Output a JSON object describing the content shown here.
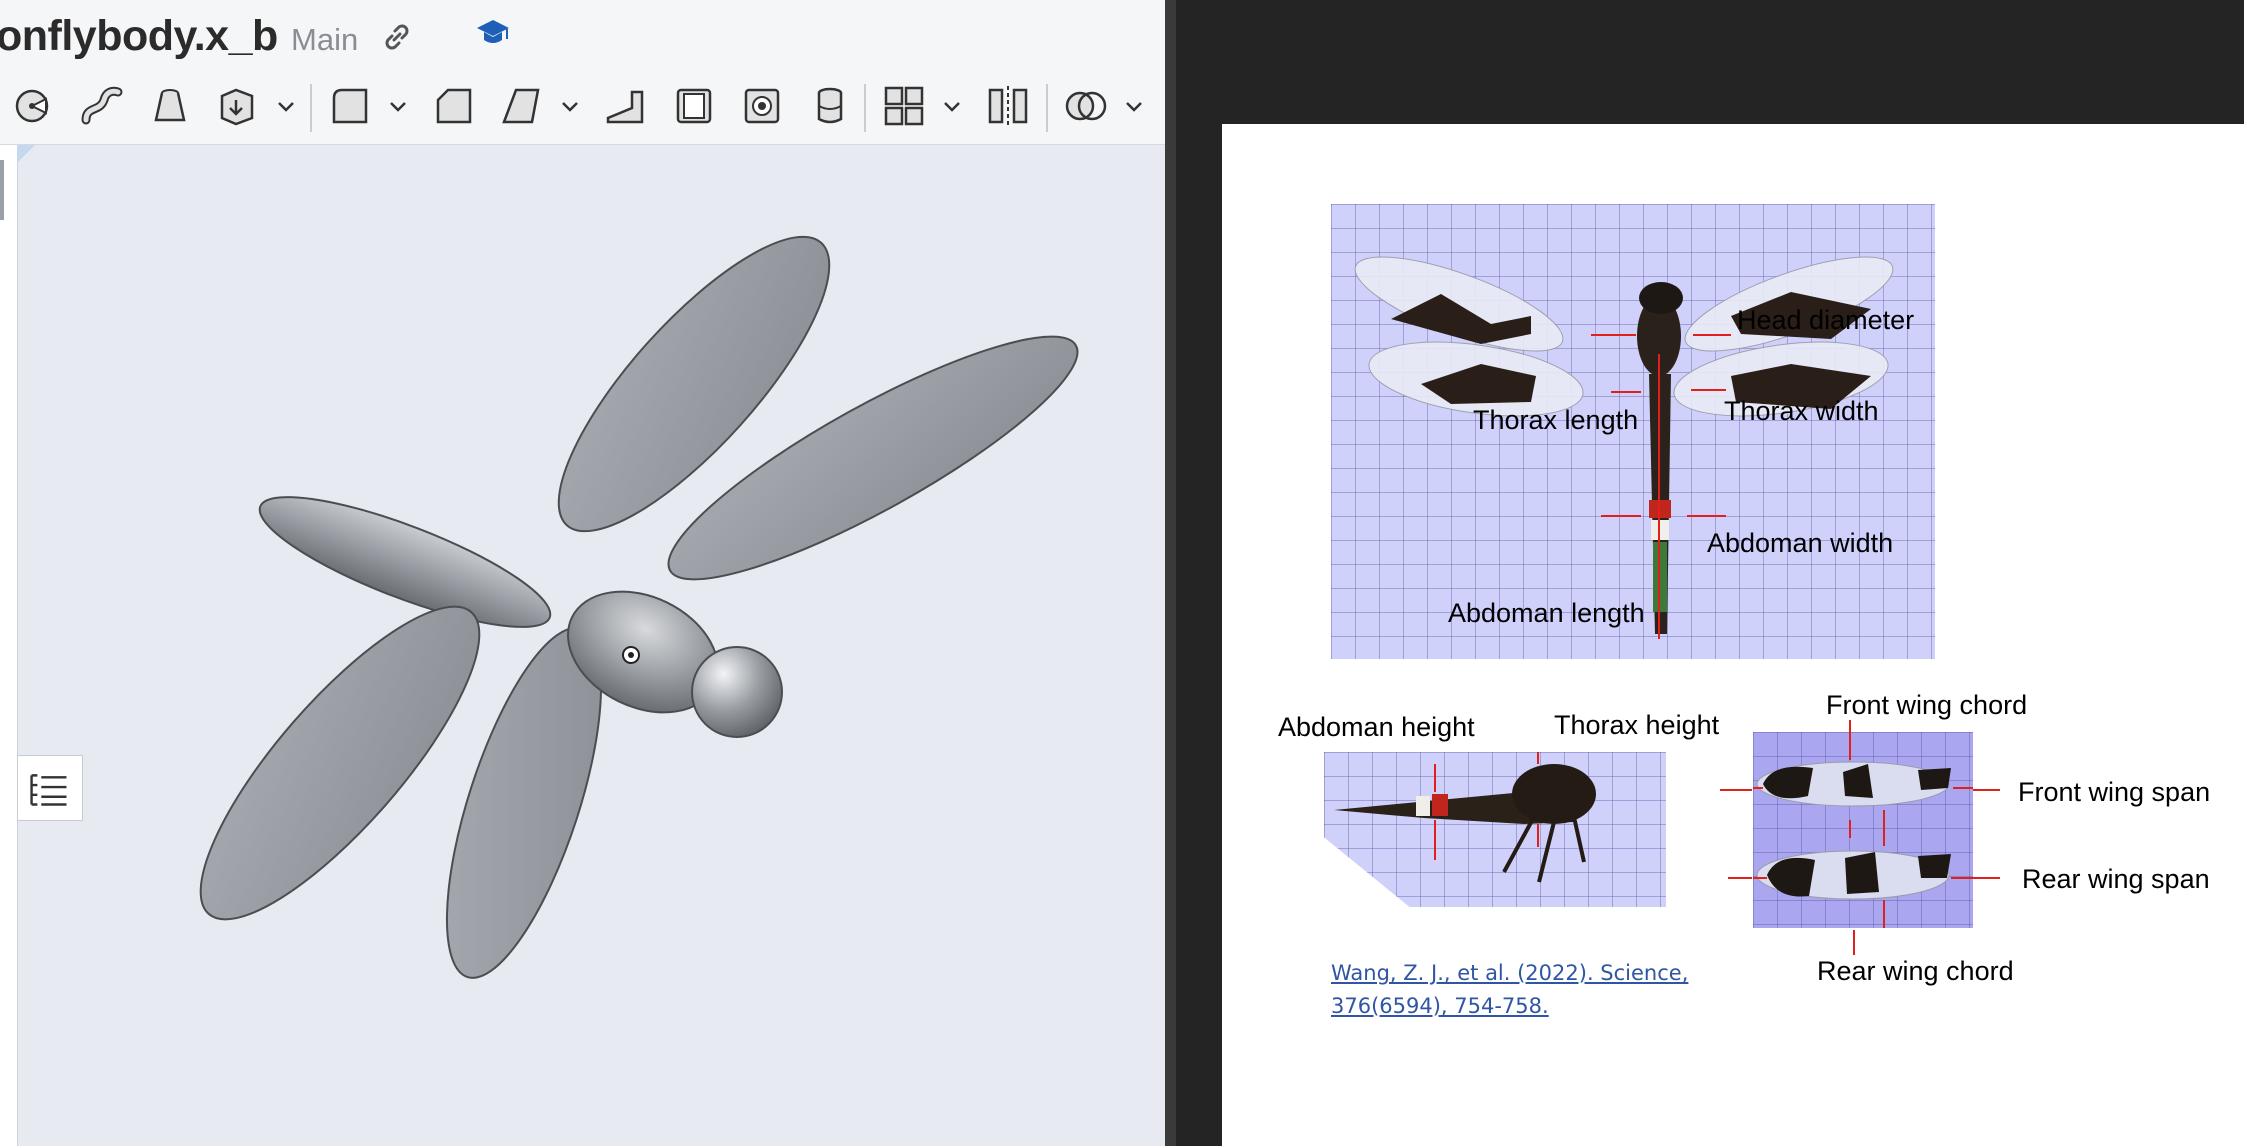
{
  "cad": {
    "document_title": "onflybody.x_b",
    "branch": "Main",
    "toolbar_tools": [
      "revolve-icon",
      "sweep-icon",
      "loft-icon",
      "thicken-icon",
      "fillet-icon",
      "chamfer-icon",
      "draft-icon",
      "rib-icon",
      "shell-icon",
      "hole-icon",
      "cylinder-icon",
      "pattern-icon",
      "mirror-icon",
      "boolean-icon"
    ],
    "model": "dragonfly body with four ellipsoid wings, thorax and spherical head"
  },
  "pdf": {
    "photo_labels": {
      "head_diameter": "Head diameter",
      "thorax_length": "Thorax length",
      "thorax_width": "Thorax width",
      "abdomen_width": "Abdoman width",
      "abdomen_length": "Abdoman length",
      "abdomen_height": "Abdoman height",
      "thorax_height": "Thorax height",
      "front_wing_chord": "Front wing chord",
      "front_wing_span": "Front wing span",
      "rear_wing_span": "Rear wing span",
      "rear_wing_chord": "Rear wing chord"
    },
    "citation_line1": "Wang, Z. J., et al. (2022). Science,",
    "citation_line2": "376(6594), 754-758.",
    "annotation_color": "#e0201c"
  }
}
